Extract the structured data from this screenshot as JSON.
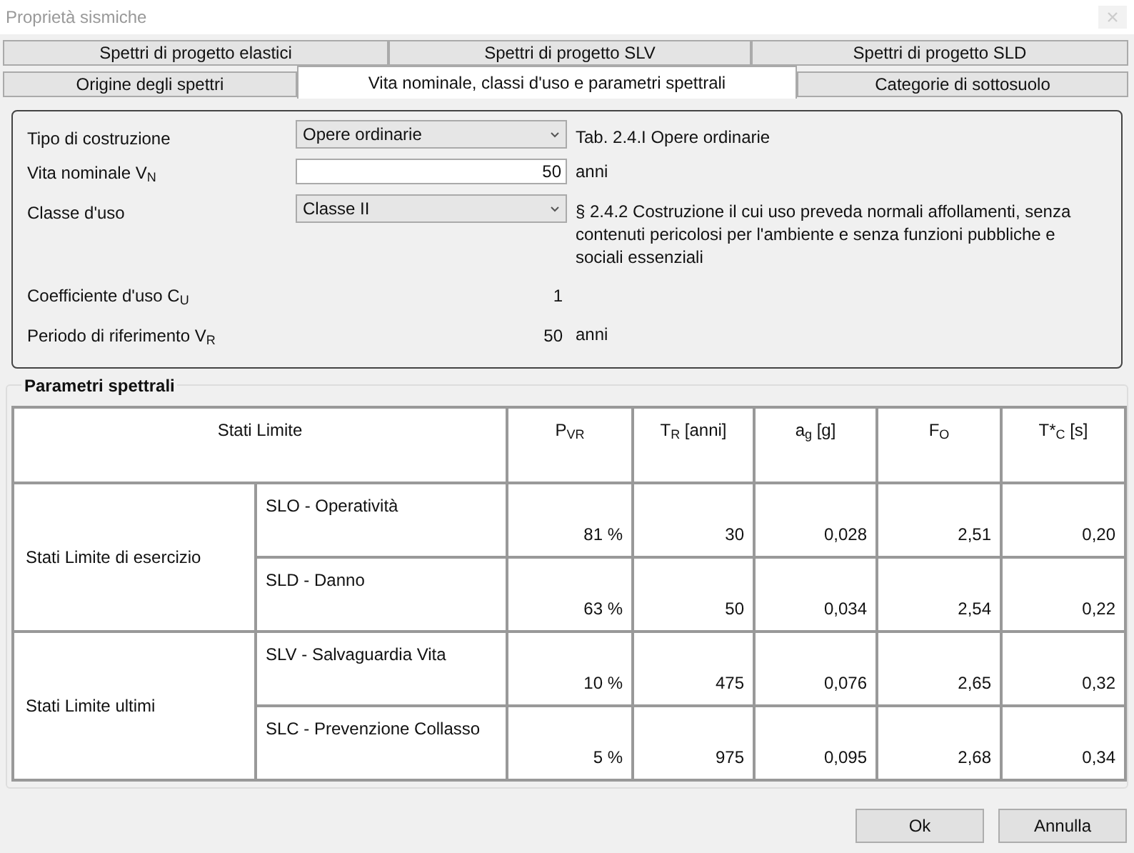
{
  "window": {
    "title": "Proprietà sismiche"
  },
  "tabs_row_1": [
    {
      "label": "Spettri di progetto elastici",
      "selected": false
    },
    {
      "label": "Spettri di progetto SLV",
      "selected": false
    },
    {
      "label": "Spettri di progetto SLD",
      "selected": false
    }
  ],
  "tabs_row_2": [
    {
      "label": "Origine degli spettri",
      "selected": false
    },
    {
      "label": "Vita nominale, classi d'uso e parametri spettrali",
      "selected": true
    },
    {
      "label": "Categorie di sottosuolo",
      "selected": false
    }
  ],
  "form": [
    {
      "kind": "combo",
      "label": "Tipo di costruzione",
      "value": "Opere ordinarie",
      "note": "Tab. 2.4.I Opere ordinarie"
    },
    {
      "kind": "input",
      "label": "Vita nominale V$_{N}$",
      "value": "50",
      "note": "anni"
    },
    {
      "kind": "combo",
      "label": "Classe d'uso",
      "value": "Classe II",
      "note": "§ 2.4.2 Costruzione il cui uso preveda normali affollamenti, senza contenuti pericolosi per l'ambiente e senza funzioni pubbliche e sociali essenziali"
    },
    {
      "kind": "readout",
      "label": "Coefficiente d'uso C$_{U}$",
      "value": "1"
    },
    {
      "kind": "readout",
      "label": "Periodo di riferimento V$_{R}$",
      "value": "50",
      "note": "anni"
    }
  ],
  "group": {
    "title": "Parametri spettrali",
    "columns": [
      "Stati Limite",
      "P$_{VR}$",
      "T$_{R}$ [anni]",
      "a$_{g}$ [g]",
      "F$_{O}$",
      "T*$_{C}$ [s]"
    ],
    "groups": [
      {
        "label": "Stati Limite di esercizio",
        "rows": [
          {
            "state": "SLO - Operatività",
            "values": [
              "81 %",
              "30",
              "0,028",
              "2,51",
              "0,20"
            ]
          },
          {
            "state": "SLD - Danno",
            "values": [
              "63 %",
              "50",
              "0,034",
              "2,54",
              "0,22"
            ]
          }
        ]
      },
      {
        "label": "Stati Limite ultimi",
        "rows": [
          {
            "state": "SLV - Salvaguardia Vita",
            "values": [
              "10 %",
              "475",
              "0,076",
              "2,65",
              "0,32"
            ]
          },
          {
            "state": "SLC - Prevenzione Collasso",
            "values": [
              "5 %",
              "975",
              "0,095",
              "2,68",
              "0,34"
            ]
          }
        ]
      }
    ]
  },
  "buttons": [
    "Ok",
    "Annulla"
  ]
}
